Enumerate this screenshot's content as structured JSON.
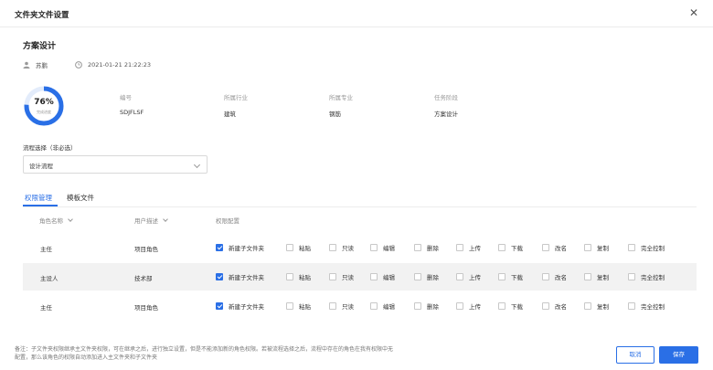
{
  "dialog": {
    "title": "文件夹文件设置",
    "close_icon": "close-icon"
  },
  "project": {
    "title": "方案设计",
    "user": "苏鹏",
    "user_icon": "user-icon",
    "time": "2021-01-21 21:22:23",
    "time_icon": "clock-icon"
  },
  "progress": {
    "percent": 76,
    "value_label": "76%",
    "sub_label": "完成进度",
    "color": "#2a6fe6",
    "track_color": "#e3ecfb"
  },
  "info": [
    {
      "label": "编号",
      "value": "SDJFLSF"
    },
    {
      "label": "所属行业",
      "value": "建筑"
    },
    {
      "label": "所属专业",
      "value": "钢筋"
    },
    {
      "label": "任务阶段",
      "value": "方案设计"
    }
  ],
  "flow": {
    "label": "流程选择（非必选）",
    "value": "设计流程"
  },
  "tabs": [
    {
      "label": "权限管理",
      "active": true
    },
    {
      "label": "模板文件",
      "active": false
    }
  ],
  "table": {
    "headers": {
      "role": "角色名称",
      "desc": "用户描述",
      "perm": "权限配置"
    },
    "perm_labels": [
      "新建子文件夹",
      "粘贴",
      "只读",
      "编辑",
      "删除",
      "上传",
      "下载",
      "改名",
      "复制",
      "完全控制"
    ],
    "rows": [
      {
        "role": "主任",
        "desc": "项目角色",
        "checked": [
          true,
          false,
          false,
          false,
          false,
          false,
          false,
          false,
          false,
          false
        ]
      },
      {
        "role": "主设人",
        "desc": "技术部",
        "checked": [
          true,
          false,
          false,
          false,
          false,
          false,
          false,
          false,
          false,
          false
        ]
      },
      {
        "role": "主任",
        "desc": "项目角色",
        "checked": [
          true,
          false,
          false,
          false,
          false,
          false,
          false,
          false,
          false,
          false
        ]
      }
    ]
  },
  "note": {
    "line1": "备注：子文件夹权限继承主文件夹权限，可在继承之后，进行独立设置，但是不能添加新的角色权限。若被流程选择之后，流程中存在的角色在我有权限中无",
    "line2": "配置，那么该角色的权限自动添加进入主文件夹和子文件夹"
  },
  "buttons": {
    "cancel": "取消",
    "save": "保存"
  },
  "colors": {
    "accent": "#2a6fe6",
    "row_shade": "#f2f2f2"
  }
}
